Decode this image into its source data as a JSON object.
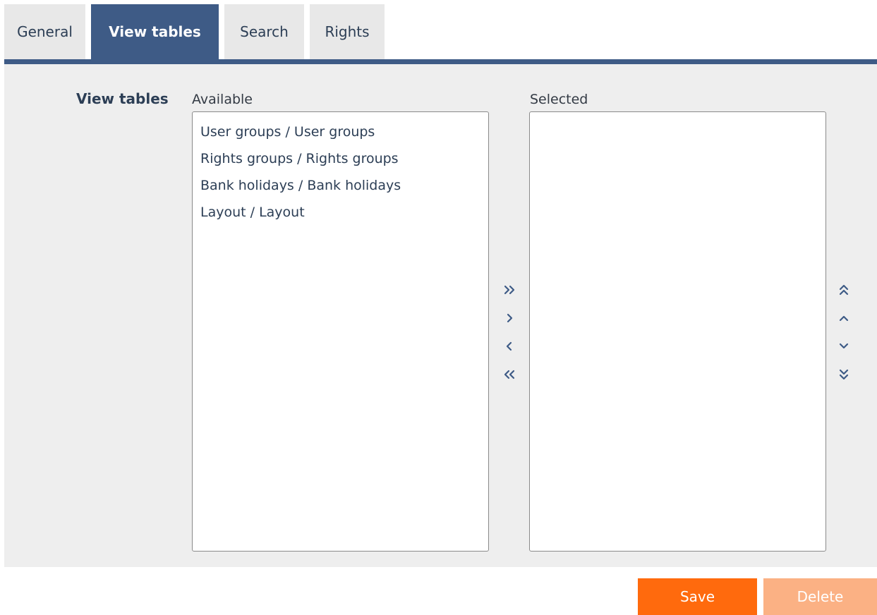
{
  "tabs": {
    "general": "General",
    "view_tables": "View tables",
    "search": "Search",
    "rights": "Rights"
  },
  "form": {
    "field_label": "View tables",
    "available_caption": "Available",
    "selected_caption": "Selected",
    "available_items": [
      "User groups / User groups",
      "Rights groups / Rights groups",
      "Bank holidays / Bank holidays",
      "Layout / Layout"
    ],
    "selected_items": []
  },
  "transfer_icons": [
    "double-chevron-right-icon",
    "chevron-right-icon",
    "chevron-left-icon",
    "double-chevron-left-icon"
  ],
  "order_icons": [
    "double-chevron-up-icon",
    "chevron-up-icon",
    "chevron-down-icon",
    "double-chevron-down-icon"
  ],
  "actions": {
    "save": "Save",
    "delete": "Delete"
  },
  "colors": {
    "accent": "#3e5b86",
    "save": "#ff6a0d",
    "delete_disabled": "#fbb184",
    "panel_bg": "#eeeeee"
  }
}
